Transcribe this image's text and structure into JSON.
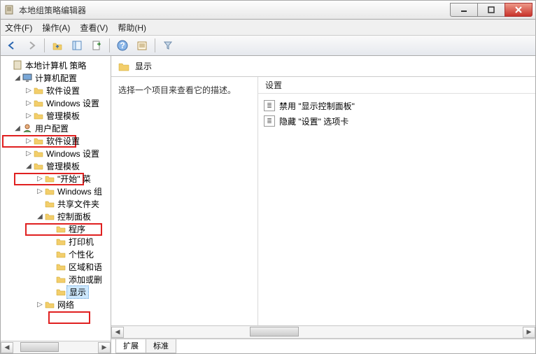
{
  "window": {
    "title": "本地组策略编辑器"
  },
  "menu": {
    "file": "文件(F)",
    "action": "操作(A)",
    "view": "查看(V)",
    "help": "帮助(H)"
  },
  "tree": {
    "root": "本地计算机 策略",
    "computer_config": "计算机配置",
    "software_settings": "软件设置",
    "windows_settings": "Windows 设置",
    "admin_templates": "管理模板",
    "user_config": "用户配置",
    "software_settings2": "软件设置",
    "windows_settings2": "Windows 设置",
    "admin_templates2": "管理模板",
    "start_menu": "\"开始\" 菜",
    "windows_comp": "Windows 组",
    "shared_folders": "共享文件夹",
    "control_panel": "控制面板",
    "programs": "程序",
    "printers": "打印机",
    "personalization": "个性化",
    "region_lang": "区域和语",
    "add_remove": "添加或删",
    "display": "显示",
    "network": "网络"
  },
  "right": {
    "header_title": "显示",
    "description_prompt": "选择一个项目来查看它的描述。",
    "settings_header": "设置",
    "settings": [
      "禁用 \"显示控制面板\"",
      "隐藏 \"设置\" 选项卡"
    ]
  },
  "tabs": {
    "extended": "扩展",
    "standard": "标准"
  }
}
